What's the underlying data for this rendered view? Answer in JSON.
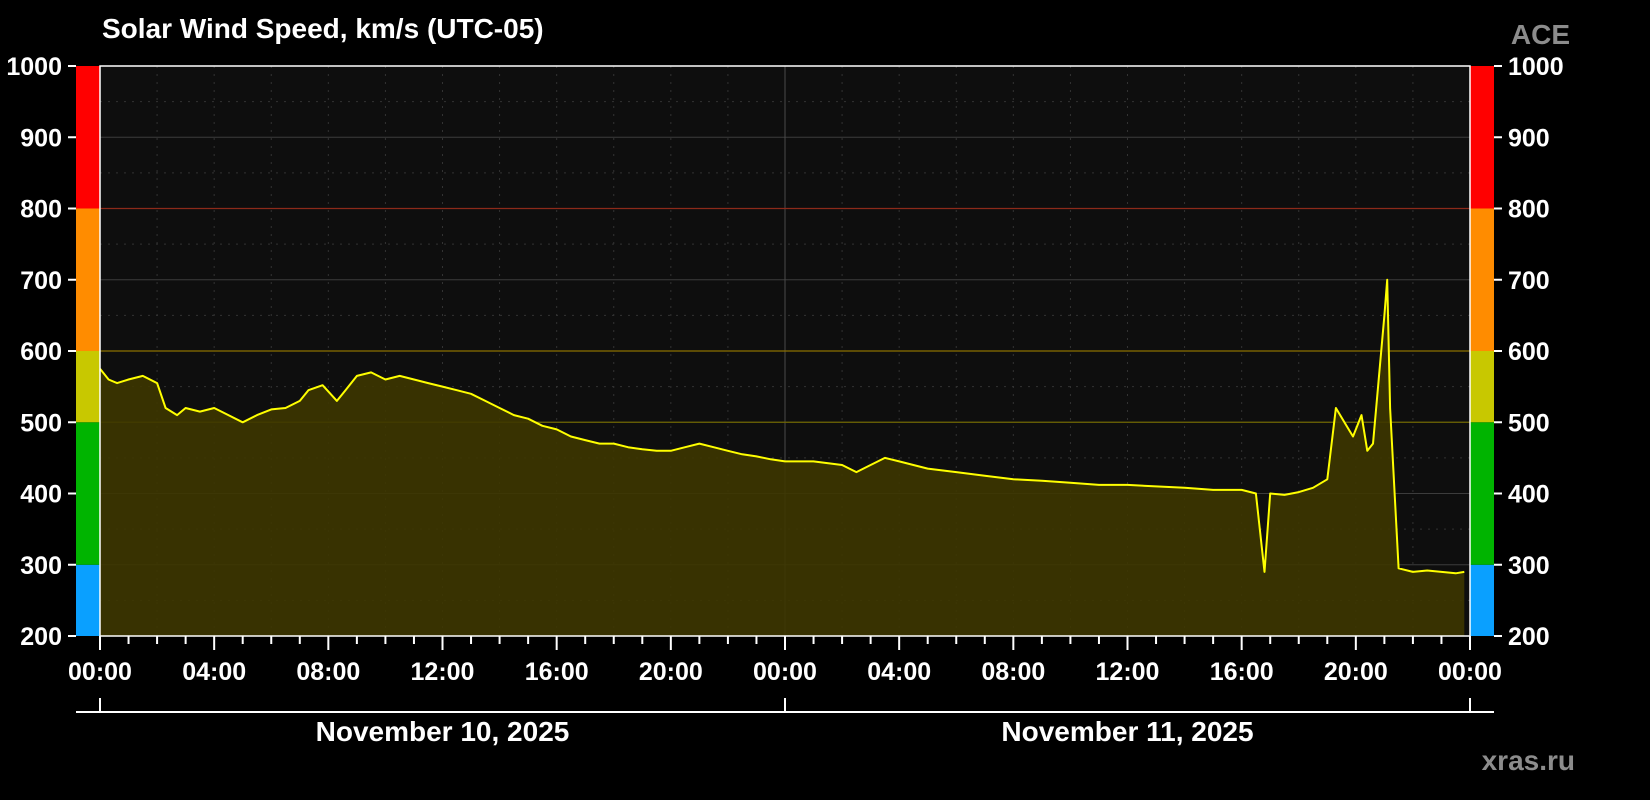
{
  "header": {
    "title": "Solar Wind Speed, km/s (UTC-05)",
    "source_badge": "ACE",
    "watermark": "xras.ru"
  },
  "colors": {
    "background": "#000000",
    "plot_background": "#0e0e0e",
    "line": "#ffff00",
    "area_fill": "#3d3600",
    "bands": [
      {
        "from": 200,
        "to": 300,
        "color": "#0aa0ff"
      },
      {
        "from": 300,
        "to": 500,
        "color": "#00b400"
      },
      {
        "from": 500,
        "to": 600,
        "color": "#c8c800"
      },
      {
        "from": 600,
        "to": 800,
        "color": "#ff8c00"
      },
      {
        "from": 800,
        "to": 1000,
        "color": "#ff0000"
      }
    ],
    "threshold_lines": [
      {
        "value": 500,
        "color": "#6e6400"
      },
      {
        "value": 600,
        "color": "#8c7000"
      },
      {
        "value": 800,
        "color": "#8c2a1a"
      }
    ]
  },
  "x_axis": {
    "tick_labels": [
      "00:00",
      "04:00",
      "08:00",
      "12:00",
      "16:00",
      "20:00",
      "00:00",
      "04:00",
      "08:00",
      "12:00",
      "16:00",
      "20:00",
      "00:00"
    ],
    "dates": [
      {
        "label": "November 10, 2025",
        "center_hour": 12
      },
      {
        "label": "November 11, 2025",
        "center_hour": 36
      }
    ]
  },
  "chart_data": {
    "type": "area",
    "title": "Solar Wind Speed, km/s (UTC-05)",
    "ylim": [
      200,
      1000
    ],
    "xlim_hours": [
      0,
      48
    ],
    "y_ticks": [
      200,
      300,
      400,
      500,
      600,
      700,
      800,
      900,
      1000
    ],
    "grid": true,
    "series": [
      {
        "x_hours": [
          0,
          0.3,
          0.6,
          1.0,
          1.5,
          2.0,
          2.3,
          2.7,
          3.0,
          3.5,
          4.0,
          4.5,
          5.0,
          5.5,
          6.0,
          6.5,
          7.0,
          7.3,
          7.8,
          8.3,
          8.6,
          9.0,
          9.5,
          10.0,
          10.5,
          11.0,
          11.5,
          12.0,
          12.5,
          13.0,
          13.5,
          14.0,
          14.5,
          15.0,
          15.5,
          16.0,
          16.5,
          17.0,
          17.5,
          18.0,
          18.5,
          19.0,
          19.5,
          20.0,
          20.5,
          21.0,
          21.5,
          22.0,
          22.5,
          23.0,
          23.5,
          24.0,
          25.0,
          26.0,
          26.5,
          27.0,
          27.5,
          28.0,
          28.5,
          29.0,
          30.0,
          31.0,
          32.0,
          33.0,
          34.0,
          35.0,
          36.0,
          37.0,
          38.0,
          39.0,
          40.0,
          40.5,
          40.8,
          41.0,
          41.5,
          42.0,
          42.5,
          43.0,
          43.3,
          43.6,
          43.9,
          44.2,
          44.4,
          44.6,
          44.8,
          45.0,
          45.1,
          45.2,
          45.5,
          46.0,
          46.5,
          47.0,
          47.5,
          47.8
        ],
        "values": [
          575,
          560,
          555,
          560,
          565,
          555,
          520,
          510,
          520,
          515,
          520,
          510,
          500,
          510,
          518,
          520,
          530,
          545,
          552,
          530,
          545,
          565,
          570,
          560,
          565,
          560,
          555,
          550,
          545,
          540,
          530,
          520,
          510,
          505,
          495,
          490,
          480,
          475,
          470,
          470,
          465,
          462,
          460,
          460,
          465,
          470,
          465,
          460,
          455,
          452,
          448,
          445,
          445,
          440,
          430,
          440,
          450,
          445,
          440,
          435,
          430,
          425,
          420,
          418,
          415,
          412,
          412,
          410,
          408,
          405,
          405,
          400,
          290,
          400,
          398,
          402,
          408,
          420,
          520,
          500,
          480,
          510,
          460,
          470,
          560,
          650,
          700,
          520,
          295,
          290,
          292,
          290,
          288,
          290
        ]
      }
    ]
  }
}
